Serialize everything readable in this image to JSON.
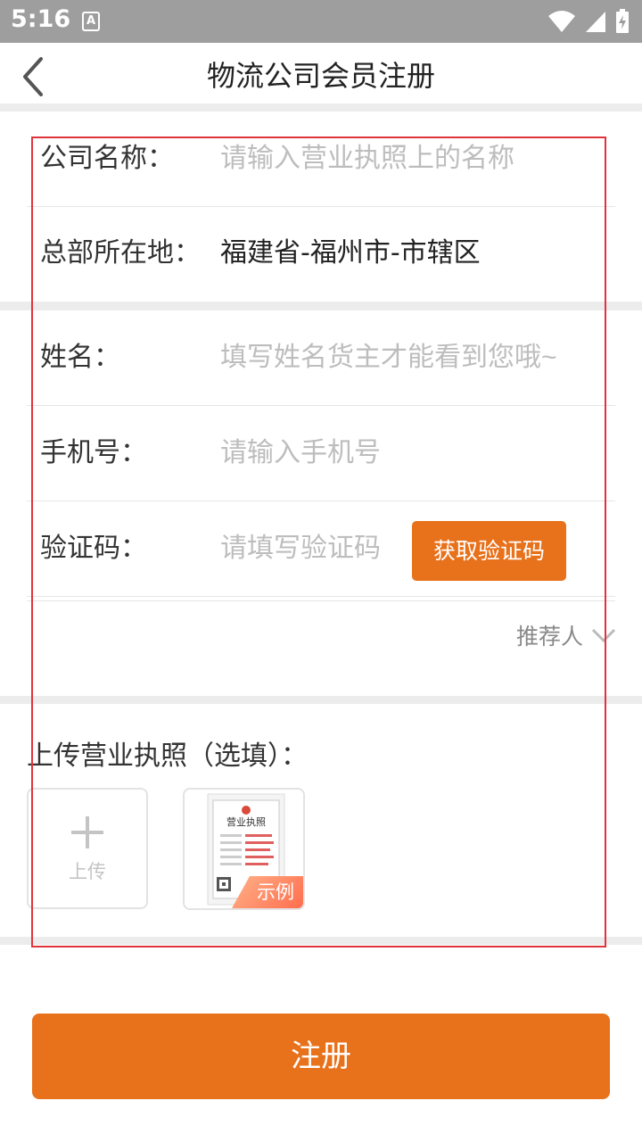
{
  "status_bar": {
    "time": "5:16",
    "notification_icon_letter": "A"
  },
  "header": {
    "title": "物流公司会员注册",
    "back_icon": "chevron-left-icon"
  },
  "company": {
    "name_label": "公司名称：",
    "name_placeholder": "请输入营业执照上的名称",
    "hq_label": "总部所在地：",
    "hq_value": "福建省-福州市-市辖区"
  },
  "personal": {
    "name_label": "姓名：",
    "name_placeholder": "填写姓名货主才能看到您哦~",
    "phone_label": "手机号：",
    "phone_placeholder": "请输入手机号",
    "code_label": "验证码：",
    "code_placeholder": "请填写验证码",
    "get_code_button": "获取验证码"
  },
  "referrer": {
    "label": "推荐人"
  },
  "upload": {
    "title": "上传营业执照（选填）：",
    "upload_label": "上传",
    "sample_tag": "示例",
    "sample_doc_title": "营业执照"
  },
  "register_button": "注册",
  "colors": {
    "accent": "#e8711b",
    "highlight_border": "#e0343c"
  }
}
